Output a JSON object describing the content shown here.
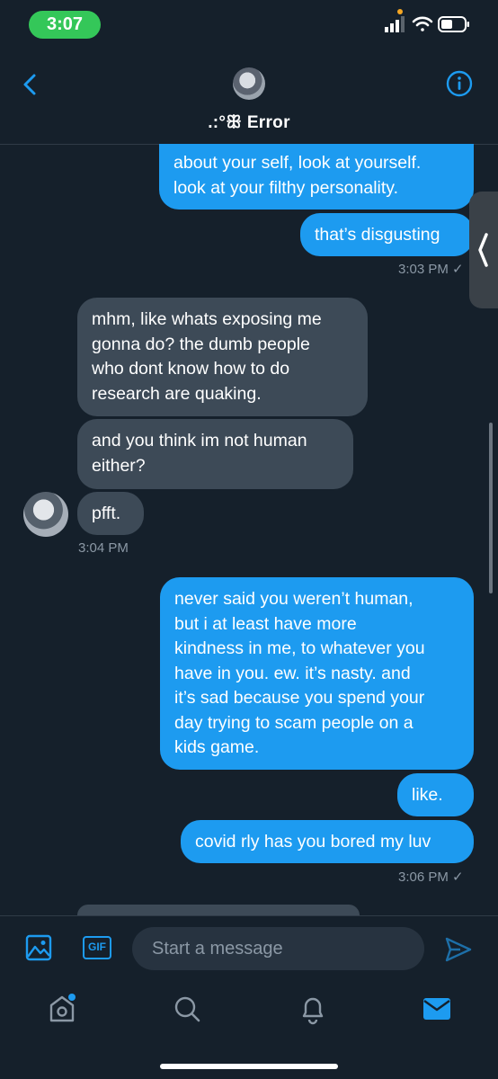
{
  "status_bar": {
    "time": "3:07"
  },
  "header": {
    "name": ".:°ꕥ Error"
  },
  "messages": {
    "m1": "about your self, look at yourself.\nlook at your filthy personality.",
    "m2": "that’s disgusting",
    "t1": "3:03 PM ✓",
    "m3": "mhm, like whats exposing me\ngonna do? the dumb people\nwho dont know how to do\nresearch are quaking.",
    "m4": "and you think im not human\neither?",
    "m5": "pfft.",
    "t2": "3:04 PM",
    "m6": "never said you weren’t human,\nbut i at least have more\nkindness in me, to whatever you\nhave in you. ew. it’s nasty. and\nit’s sad because you spend your\nday trying to scam people on a\nkids game.",
    "m7": "like.",
    "m8": "covid rly has you bored my luv",
    "t3": "3:06 PM ✓"
  },
  "composer": {
    "placeholder": "Start a message",
    "gif_label": "GIF"
  },
  "colors": {
    "background": "#15202b",
    "sent_bubble": "#1d9bf0",
    "received_bubble": "#3d4a57",
    "accent": "#1d9bf0"
  },
  "icons": [
    "back-arrow-icon",
    "info-icon",
    "image-icon",
    "gif-icon",
    "send-icon",
    "home-icon",
    "search-icon",
    "bell-icon",
    "mail-icon"
  ]
}
